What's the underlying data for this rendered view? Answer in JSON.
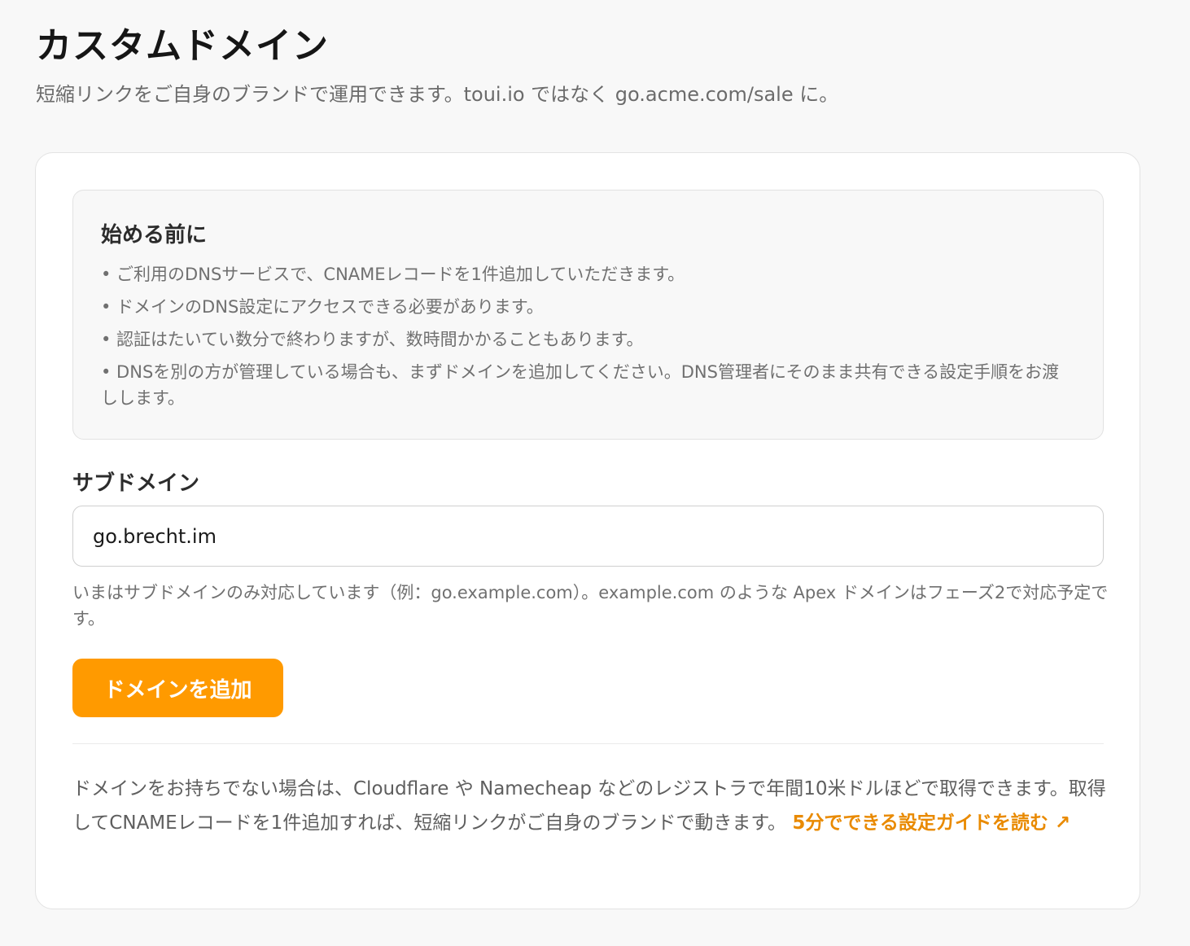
{
  "header": {
    "title": "カスタムドメイン",
    "subtitle": "短縮リンクをご自身のブランドで運用できます。toui.io ではなく go.acme.com/sale に。"
  },
  "info": {
    "title": "始める前に",
    "items": [
      "• ご利用のDNSサービスで、CNAMEレコードを1件追加していただきます。",
      "• ドメインのDNS設定にアクセスできる必要があります。",
      "• 認証はたいてい数分で終わりますが、数時間かかることもあります。",
      "• DNSを別の方が管理している場合も、まずドメインを追加してください。DNS管理者にそのまま共有できる設定手順をお渡しします。"
    ]
  },
  "subdomain": {
    "label": "サブドメイン",
    "value": "go.brecht.im",
    "help": "いまはサブドメインのみ対応しています（例：go.example.com）。example.com のような Apex ドメインはフェーズ2で対応予定です。"
  },
  "add_button": {
    "label": "ドメインを追加"
  },
  "footer": {
    "text": "ドメインをお持ちでない場合は、Cloudflare や Namecheap などのレジストラで年間10米ドルほどで取得できます。取得してCNAMEレコードを1件追加すれば、短縮リンクがご自身のブランドで動きます。",
    "link_label": "5分でできる設定ガイドを読む ↗"
  },
  "colors": {
    "accent": "#ff9a00",
    "link": "#e98a00",
    "background": "#f8f8f8",
    "card": "#ffffff"
  }
}
